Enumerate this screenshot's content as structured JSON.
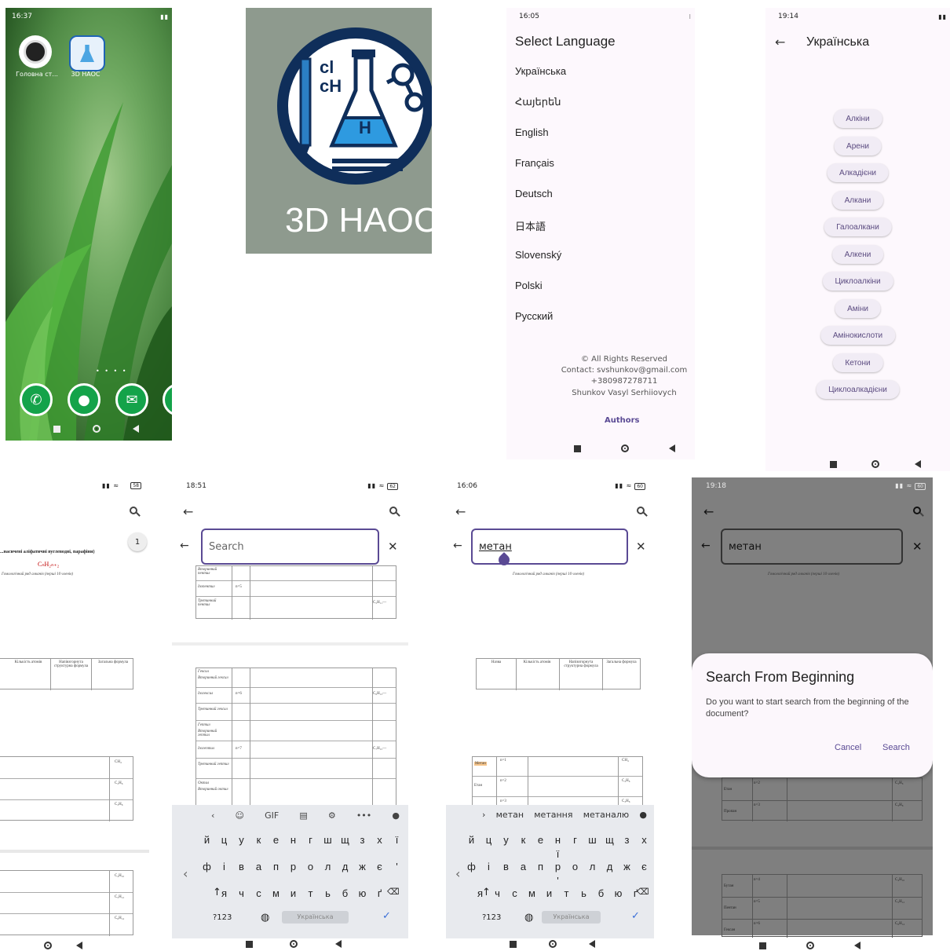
{
  "home": {
    "time": "16:37",
    "app1_label": "Головна ст...",
    "app2_label": "3D HAOC"
  },
  "splash": {
    "logo_text": "3D HAOC",
    "flask_text_1": "cl",
    "flask_text_2": "cH",
    "flask_text_3": "H"
  },
  "language_screen": {
    "time": "16:05",
    "title": "Select Language",
    "languages": [
      "Українська",
      "Հայերեն",
      "English",
      "Français",
      "Deutsch",
      "日本語",
      "Slovenský",
      "Polski",
      "Русский"
    ],
    "footer_line1": "© All Rights Reserved",
    "footer_line2": "Contact: svshunkov@gmail.com",
    "footer_line3": "+380987278711",
    "footer_line4": "Shunkov Vasyl Serhiiovych",
    "authors": "Authors"
  },
  "topics_screen": {
    "time": "19:14",
    "title": "Українська",
    "topics": [
      "Алкіни",
      "Арени",
      "Алкадієни",
      "Алкани",
      "Галоалкани",
      "Алкени",
      "Циклоалкіни",
      "Аміни",
      "Амінокислоти",
      "Кетони",
      "Циклоалкадієни"
    ]
  },
  "doc_screen": {
    "page_badge": "1",
    "heading": "...насичені аліфатичні вуглеводні, парафіни)",
    "formula": "CₙH₂ₙ₊₂",
    "subheading": "Гомологічний ряд алканів (перші 10 членів)",
    "col_count": "Кількість атомів",
    "col_struct": "Напівзгорнута структурна формула",
    "col_general": "Загальна формула",
    "row_formulas": [
      "CH₄",
      "C₂H₆",
      "C₃H₈",
      "C₄H₁₀",
      "C₅H₁₂",
      "C₆H₁₄"
    ]
  },
  "search_empty_screen": {
    "time": "18:51",
    "placeholder": "Search",
    "names": [
      "Вторинний пентил",
      "Ізопентил",
      "Третинний пентил",
      "Гексил",
      "Вторинний гексил",
      "Ізогексил",
      "Третинний гексил",
      "Гептил",
      "Вторинний гептил",
      "Ізогептил",
      "Третинний гептил",
      "Октил",
      "Вторинний октил"
    ],
    "counts": [
      "n=5",
      "n=6",
      "n=7"
    ],
    "formulas": [
      "C₅H₁₁—",
      "C₆H₁₃—",
      "C₇H₁₅—"
    ],
    "keyboard": {
      "row1": [
        "й",
        "ц",
        "у",
        "к",
        "е",
        "н",
        "г",
        "ш",
        "щ",
        "з",
        "х",
        "ї"
      ],
      "row2": [
        "ф",
        "і",
        "в",
        "а",
        "п",
        "р",
        "о",
        "л",
        "д",
        "ж",
        "є",
        "'"
      ],
      "row3": [
        "я",
        "ч",
        "с",
        "м",
        "и",
        "т",
        "ь",
        "б",
        "ю",
        "ґ"
      ],
      "mode": "?123",
      "space": "Українська",
      "gif": "GIF"
    }
  },
  "search_typed_screen": {
    "time": "16:06",
    "query": "метан",
    "subheading": "Гомологічний ряд алканів (перші 10 членів)",
    "table_cols": [
      "Назва",
      "Кількість атомів",
      "Напівзгорнута структурна формула",
      "Загальна формула"
    ],
    "rows": [
      {
        "name": "Метан",
        "n": "n=1",
        "formula": "CH₄"
      },
      {
        "name": "Етан",
        "n": "n=2",
        "formula": "C₂H₆"
      },
      {
        "name": "",
        "n": "n=3",
        "formula": "C₃H₈"
      }
    ],
    "suggestions": [
      "метан",
      "метання",
      "метаналю"
    ],
    "keyboard": {
      "row1": [
        "й",
        "ц",
        "у",
        "к",
        "е",
        "н",
        "г",
        "ш",
        "щ",
        "з",
        "х",
        "ї"
      ],
      "row2": [
        "ф",
        "і",
        "в",
        "а",
        "п",
        "р",
        "о",
        "л",
        "д",
        "ж",
        "є",
        "'"
      ],
      "row3": [
        "я",
        "ч",
        "с",
        "м",
        "и",
        "т",
        "ь",
        "б",
        "ю",
        "ґ"
      ],
      "mode": "?123",
      "space": "Українська"
    }
  },
  "dialog_screen": {
    "time": "19:18",
    "query": "метан",
    "subheading": "Гомологічний ряд алканів (перші 10 членів)",
    "dialog_title": "Search From Beginning",
    "dialog_body": "Do you want to start search from the beginning of the document?",
    "cancel": "Cancel",
    "search": "Search",
    "rows_top": [
      {
        "name": "Етан",
        "n": "n=2",
        "formula": "C₂H₆"
      },
      {
        "name": "Пропан",
        "n": "n=3",
        "formula": "C₃H₈"
      }
    ],
    "rows_bottom": [
      {
        "name": "Бутан",
        "n": "n=4",
        "formula": "C₄H₁₀"
      },
      {
        "name": "Пентан",
        "n": "n=5",
        "formula": "C₅H₁₂"
      },
      {
        "name": "Гексан",
        "n": "n=6",
        "formula": "C₆H₁₄"
      }
    ]
  }
}
